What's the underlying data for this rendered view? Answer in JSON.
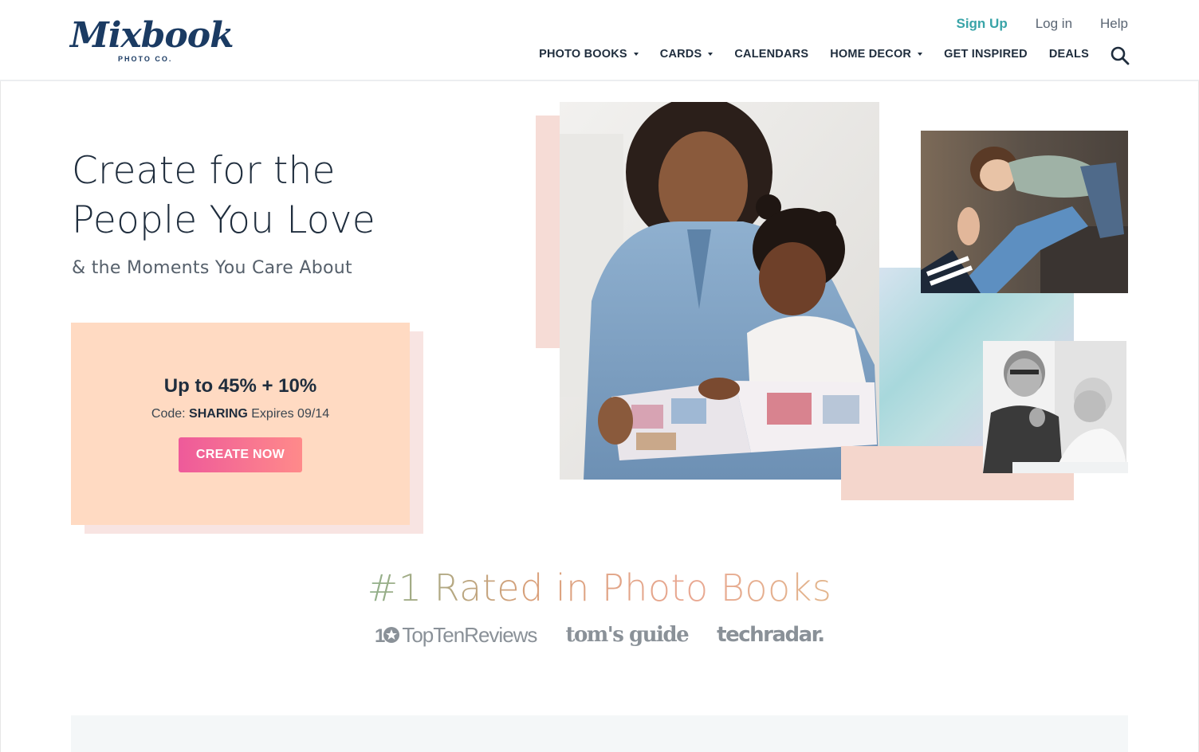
{
  "header": {
    "logo": {
      "name": "Mixbook",
      "sub": "PHOTO CO."
    },
    "utility_nav": [
      "Sign Up",
      "Log in",
      "Help"
    ],
    "main_nav": [
      {
        "label": "PHOTO BOOKS",
        "dropdown": true
      },
      {
        "label": "CARDS",
        "dropdown": true
      },
      {
        "label": "CALENDARS",
        "dropdown": false
      },
      {
        "label": "HOME DECOR",
        "dropdown": true
      },
      {
        "label": "GET INSPIRED",
        "dropdown": false
      },
      {
        "label": "DEALS",
        "dropdown": false
      }
    ],
    "search_icon": "search-icon"
  },
  "hero": {
    "title_line1": "Create for the",
    "title_line2": "People You Love",
    "subtitle": "& the Moments You Care About"
  },
  "promo": {
    "headline": "Up to 45% + 10%",
    "code_prefix": "Code: ",
    "code": "SHARING",
    "expires": " Expires 09/14",
    "cta": "CREATE NOW"
  },
  "rated": {
    "heading": "#1 Rated in Photo Books",
    "press": [
      "TopTenReviews",
      "tom's guide",
      "techradar."
    ]
  },
  "colors": {
    "brand_navy": "#1b3b63",
    "signup_teal": "#39a4a8",
    "promo_bg": "#ffdac2",
    "cta_start": "#ee5a9a",
    "cta_end": "#ff8a8a"
  }
}
